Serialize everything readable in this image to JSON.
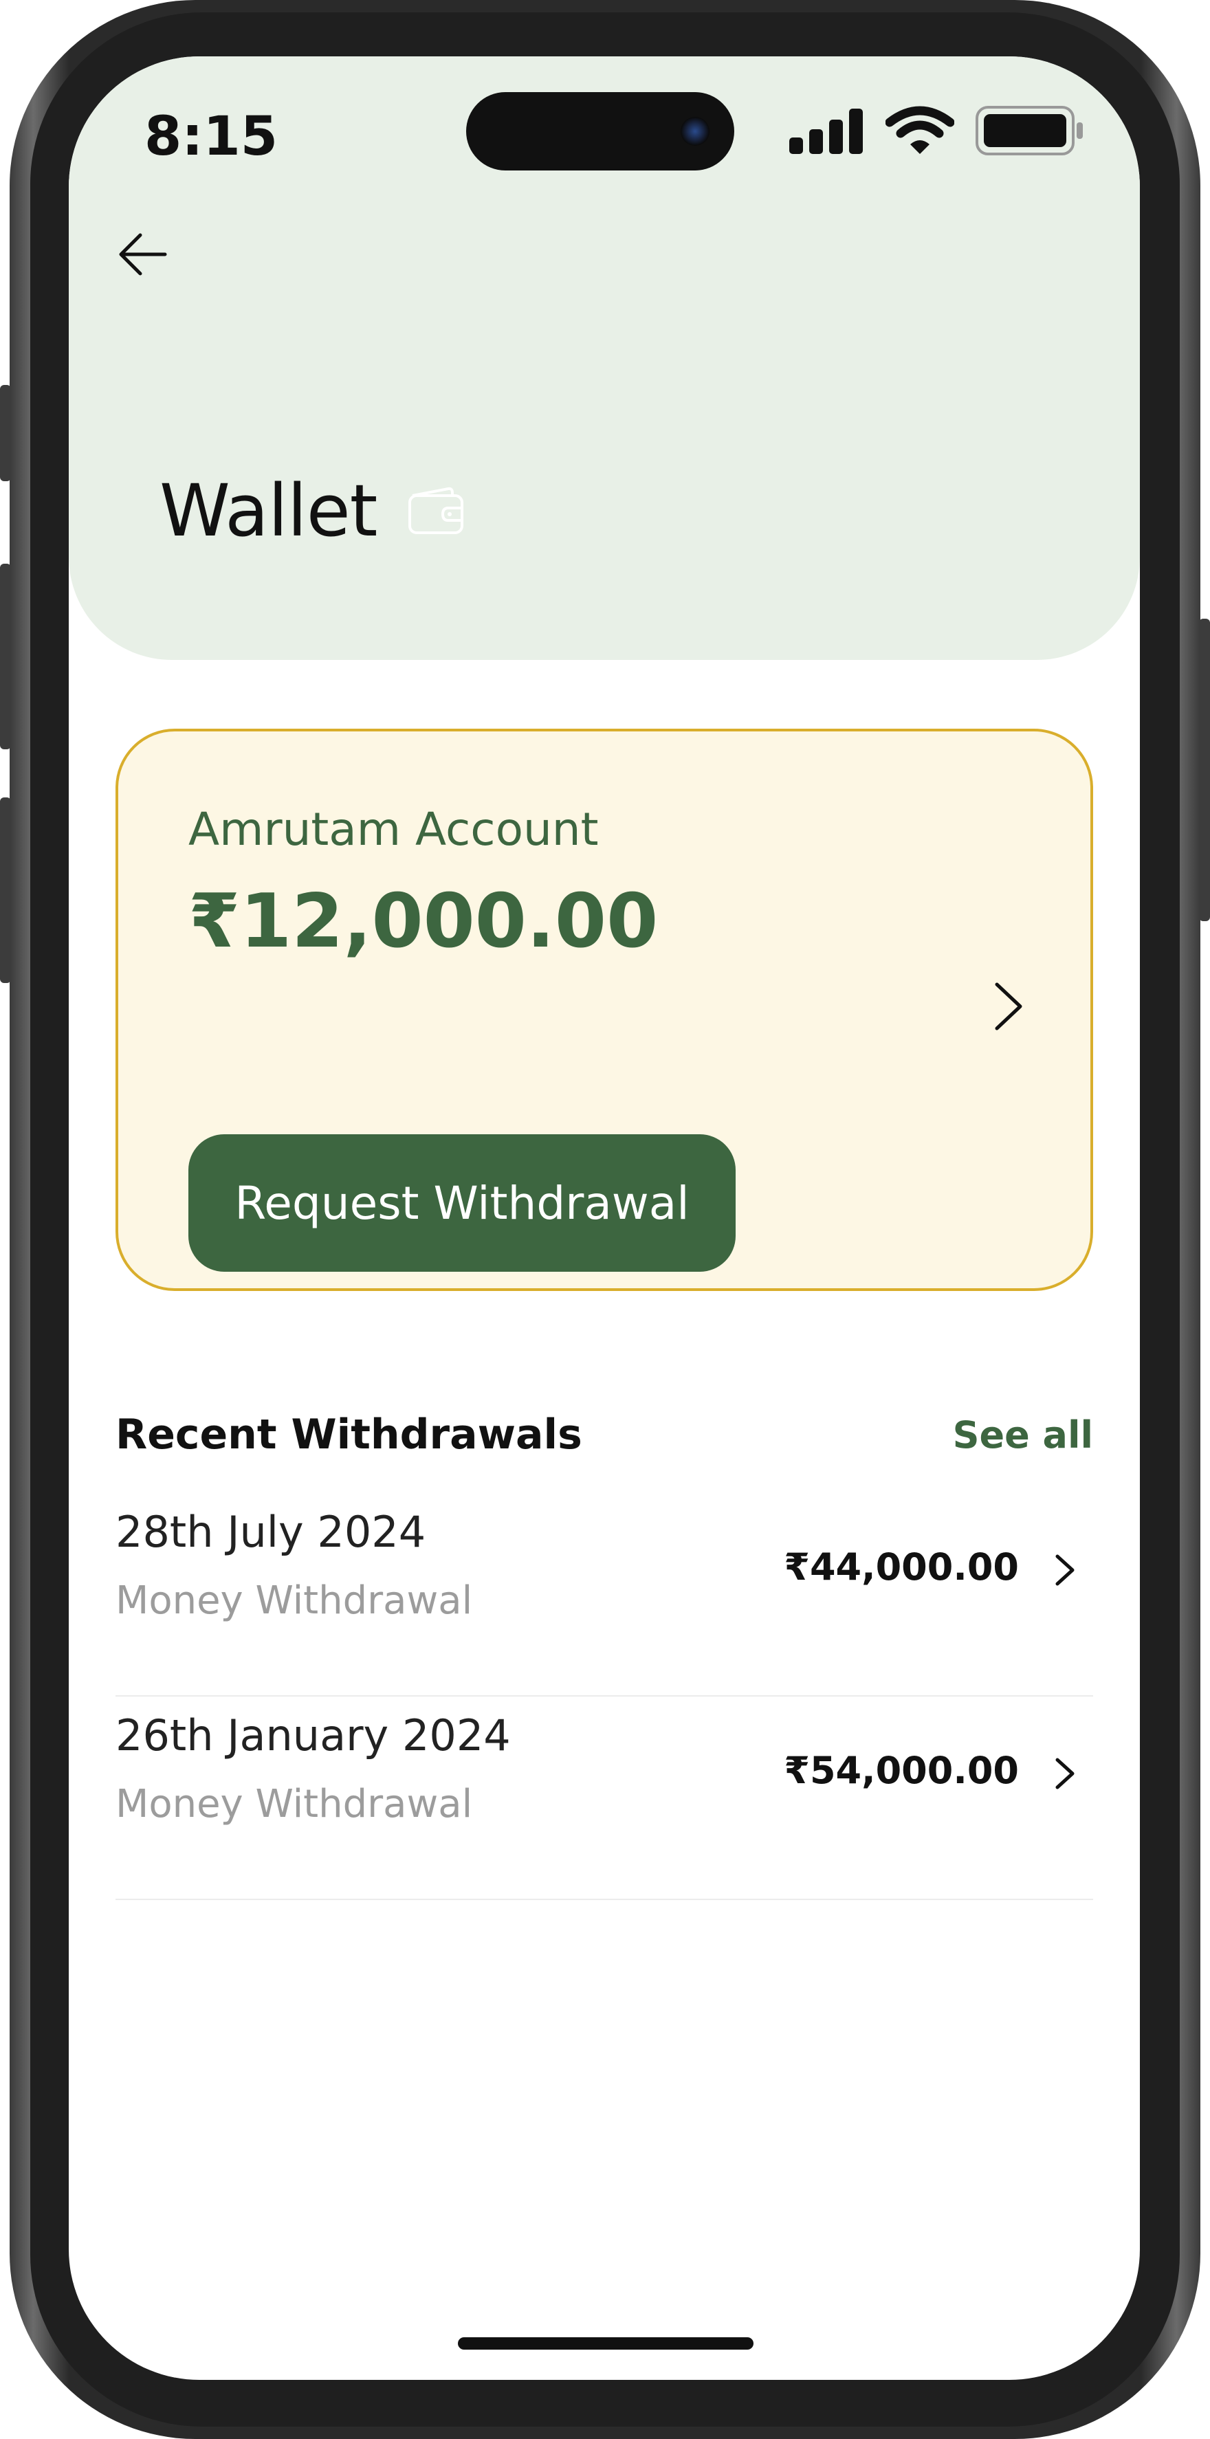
{
  "status_bar": {
    "time": "8:15"
  },
  "header": {
    "back_icon": "arrow-left-icon",
    "title": "Wallet",
    "title_icon": "wallet-icon"
  },
  "account_card": {
    "label": "Amrutam Account",
    "balance": "₹12,000.00",
    "withdraw_button_label": "Request Withdrawal",
    "chevron_icon": "chevron-right-icon"
  },
  "recent": {
    "title": "Recent Withdrawals",
    "see_all_label": "See all",
    "items": [
      {
        "date": "28th July 2024",
        "type": "Money Withdrawal",
        "amount": "₹44,000.00"
      },
      {
        "date": "26th January 2024",
        "type": "Money Withdrawal",
        "amount": "₹54,000.00"
      }
    ]
  },
  "colors": {
    "header_bg": "#e8f0e7",
    "accent_green": "#3d6640",
    "card_bg": "#fdf7e4",
    "card_border": "#d9ae2c"
  }
}
